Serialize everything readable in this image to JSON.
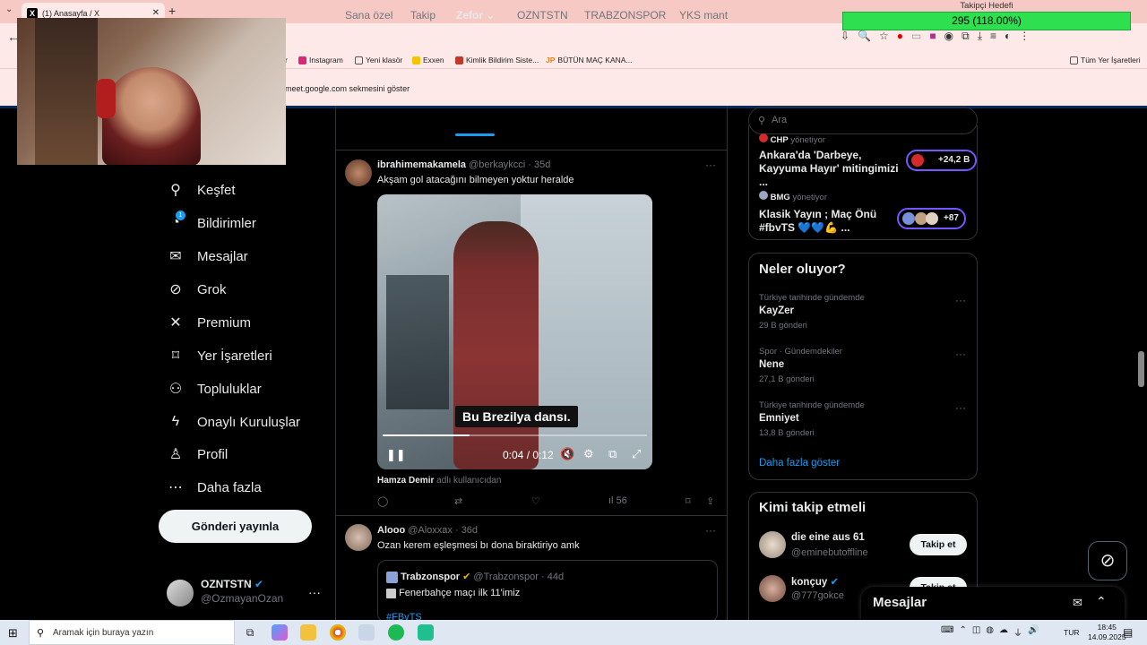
{
  "browser": {
    "tab_title": "(1) Anasayfa / X",
    "tab_logo": "X",
    "tab_close": "✕",
    "new_tab": "+",
    "tab_menu": "⌄",
    "back": "←",
    "bookmarks": [
      {
        "label": "Instagram",
        "color": "#d62976"
      },
      {
        "label": "Yeni klasör",
        "color": "#555555"
      },
      {
        "label": "Exxen",
        "color": "#f5c400"
      },
      {
        "label": "Kimlik Bildirim Siste...",
        "color": "#c0392b"
      },
      {
        "label": "BÜTÜN MAÇ KANA...",
        "color": "#e67e22"
      },
      {
        "label": "Tüm Yer İşaretleri",
        "color": "#555555"
      }
    ],
    "bookmark_prefixes": [
      "r",
      "JP"
    ],
    "infobar_text": "meet.google.com sekmesini göster"
  },
  "goal": {
    "title": "Takipçi Hedefi",
    "value": "295 (118.00%)",
    "percent": 118
  },
  "nav": {
    "items": [
      {
        "label": "Keşfet",
        "icon": "search-icon",
        "glyph": "⚲"
      },
      {
        "label": "Bildirimler",
        "icon": "bell-icon",
        "glyph": "🔔"
      },
      {
        "label": "Mesajlar",
        "icon": "mail-icon",
        "glyph": "✉"
      },
      {
        "label": "Grok",
        "icon": "grok-icon",
        "glyph": "⊘"
      },
      {
        "label": "Premium",
        "icon": "x-logo-icon",
        "glyph": "✕"
      },
      {
        "label": "Yer İşaretleri",
        "icon": "bookmark-icon",
        "glyph": "⚑"
      },
      {
        "label": "Topluluklar",
        "icon": "people-icon",
        "glyph": "👥"
      },
      {
        "label": "Onaylı Kuruluşlar",
        "icon": "lightning-icon",
        "glyph": "ϟ"
      },
      {
        "label": "Profil",
        "icon": "person-icon",
        "glyph": "👤"
      },
      {
        "label": "Daha fazla",
        "icon": "more-circle-icon",
        "glyph": "⋯"
      }
    ],
    "notif_count": "1",
    "post_button": "Gönderi yayınla",
    "profile_name": "OZNTSTN",
    "profile_handle": "@OzmayanOzan",
    "profile_more": "···"
  },
  "timeline": {
    "tabs": [
      "Sana özel",
      "Takip",
      "Zefor",
      "OZNTSTN",
      "TRABZONSPOR",
      "YKS mant"
    ],
    "tab_chevron": "⌄",
    "tweet1": {
      "name": "ibrahimemakamela",
      "handle_time": "@berkaykcci · 35d",
      "text": "Akşam gol atacağını bilmeyen yoktur heralde",
      "video_subtitle": "Bu Brezilya dansı.",
      "video_time": "0:04 / 0:12",
      "progress": 0.33,
      "credit_name": "Hamza Demir",
      "credit_suffix": "adlı kullanıcıdan",
      "views": "56"
    },
    "tweet2": {
      "name": "Alooo",
      "handle_time": "@Aloxxax · 36d",
      "text": "Ozan kerem eşleşmesi bı dona biraktiriyo amk",
      "quote_name": "Trabzonspor",
      "quote_handle_time": "@Trabzonspor · 44d",
      "quote_text": "Fenerbahçe maçı ilk 11'imiz",
      "quote_hashtag": "#FBvTS"
    },
    "more": "···"
  },
  "right": {
    "search_placeholder": "Ara",
    "live": [
      {
        "host": "CHP",
        "role": "yönetiyor",
        "title": "Ankara'da 'Darbeye, Kayyuma Hayır' mitingimizi ...",
        "pill": "+24,2 B"
      },
      {
        "host": "BMG",
        "role": "yönetiyor",
        "title": "Klasik Yayın ; Maç Önü #fbvTS 💙💙💪 ...",
        "pill": "+87"
      }
    ],
    "whats_happening_title": "Neler oluyor?",
    "trends": [
      {
        "meta": "Türkiye tarihinde gündemde",
        "name": "KayZer",
        "count": "29 B gönderi"
      },
      {
        "meta": "Spor · Gündemdekiler",
        "name": "Nene",
        "count": "27,1 B gönderi"
      },
      {
        "meta": "Türkiye tarihinde gündemde",
        "name": "Emniyet",
        "count": "13,8 B gönderi"
      }
    ],
    "show_more": "Daha fazla göster",
    "who_to_follow_title": "Kimi takip etmeli",
    "who": [
      {
        "name": "die eine aus 61",
        "handle": "@eminebutoffline",
        "button": "Takip et"
      },
      {
        "name": "konçuy",
        "handle": "@777gokce",
        "button": "Takip et"
      }
    ],
    "messages_title": "Mesajlar"
  },
  "taskbar": {
    "search_placeholder": "Aramak için buraya yazın",
    "lang": "TUR",
    "time": "18:45",
    "date": "14.09.2025"
  },
  "colors": {
    "accent": "#1d9bf0",
    "goal_bar": "#2ee04f",
    "live_pill_border": "#7856ff"
  }
}
